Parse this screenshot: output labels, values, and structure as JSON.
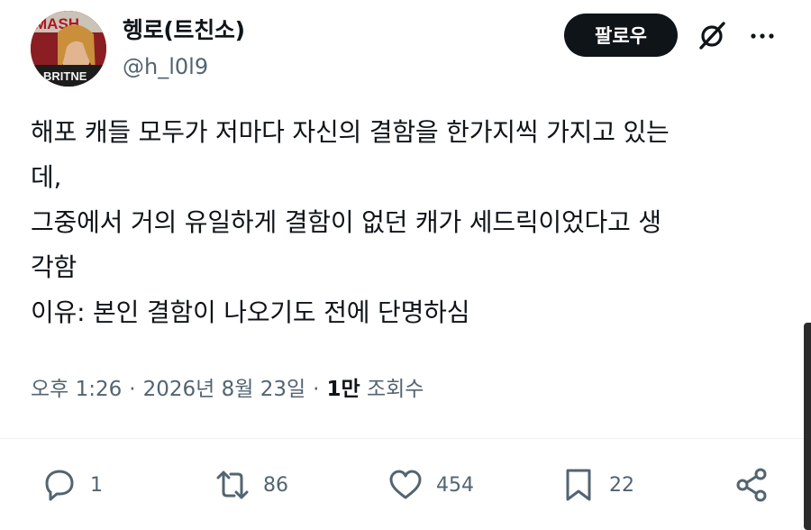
{
  "author": {
    "display_name": "헹로(트친소)",
    "handle": "@h_l0l9",
    "avatar_text_top": "MASH",
    "avatar_text_bottom": "BRITNE"
  },
  "header": {
    "follow_label": "팔로우",
    "grok_icon": "grok-slash-icon",
    "more_icon": "more-horizontal-icon"
  },
  "tweet": {
    "lines": [
      "해포 캐들 모두가 저마다 자신의 결함을 한가지씩 가지고 있는",
      "데,",
      "그중에서 거의 유일하게 결함이 없던 캐가 세드릭이었다고 생",
      "각함",
      "이유: 본인 결함이 나오기도 전에 단명하심"
    ]
  },
  "meta": {
    "time": "오후 1:26",
    "date": "2026년 8월 23일",
    "views_count": "1만",
    "views_label": "조회수",
    "separator": "·"
  },
  "actions": {
    "reply": {
      "icon": "reply-icon",
      "count": "1"
    },
    "retweet": {
      "icon": "retweet-icon",
      "count": "86"
    },
    "like": {
      "icon": "heart-icon",
      "count": "454"
    },
    "bookmark": {
      "icon": "bookmark-icon",
      "count": "22"
    },
    "share": {
      "icon": "share-icon"
    }
  },
  "colors": {
    "text_primary": "#0f1419",
    "text_secondary": "#536471",
    "button_bg": "#0f1419",
    "button_text": "#ffffff",
    "divider": "#eff3f4"
  }
}
